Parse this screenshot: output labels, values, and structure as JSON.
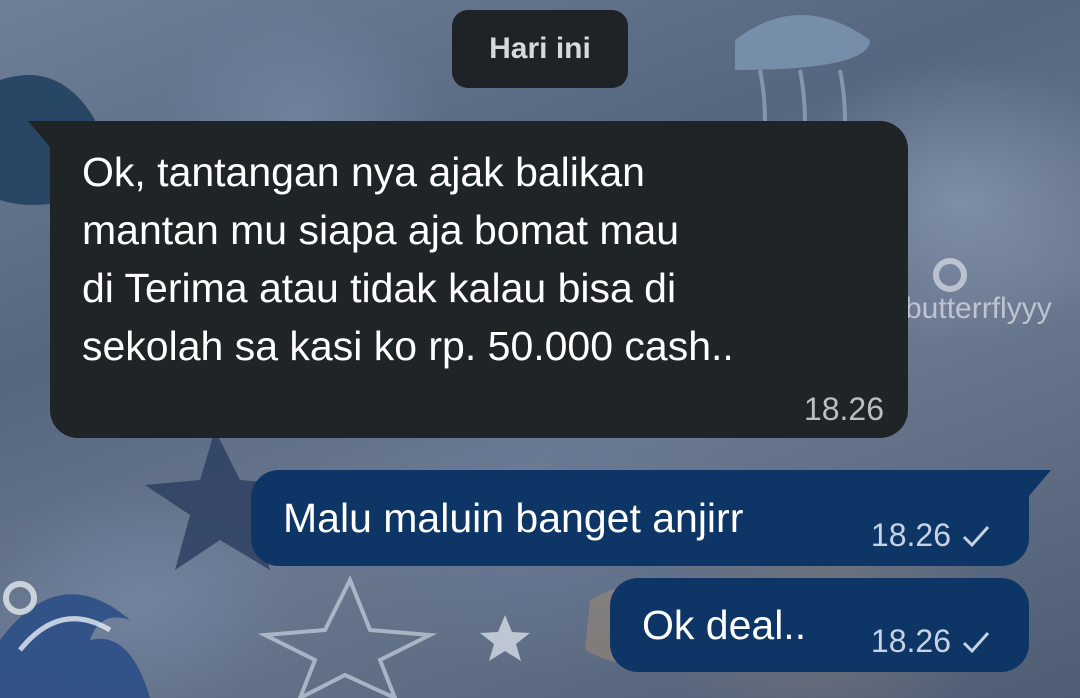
{
  "chat": {
    "date_label": "Hari ini",
    "watermark": "butterrflyyy",
    "messages": [
      {
        "direction": "incoming",
        "text": "Ok, tantangan nya ajak balikan\nmantan mu siapa aja bomat mau\ndi Terima atau tidak kalau bisa di\nsekolah sa kasi ko rp. 50.000 cash..",
        "time": "18.26"
      },
      {
        "direction": "outgoing",
        "text": "Malu maluin banget anjirr",
        "time": "18.26",
        "status_icon": "check-icon"
      },
      {
        "direction": "outgoing",
        "text": "Ok deal..",
        "time": "18.26",
        "status_icon": "check-icon"
      }
    ]
  },
  "colors": {
    "incoming_bubble": "#1f2427",
    "outgoing_bubble": "#0d3566",
    "date_pill": "#1f2327"
  }
}
